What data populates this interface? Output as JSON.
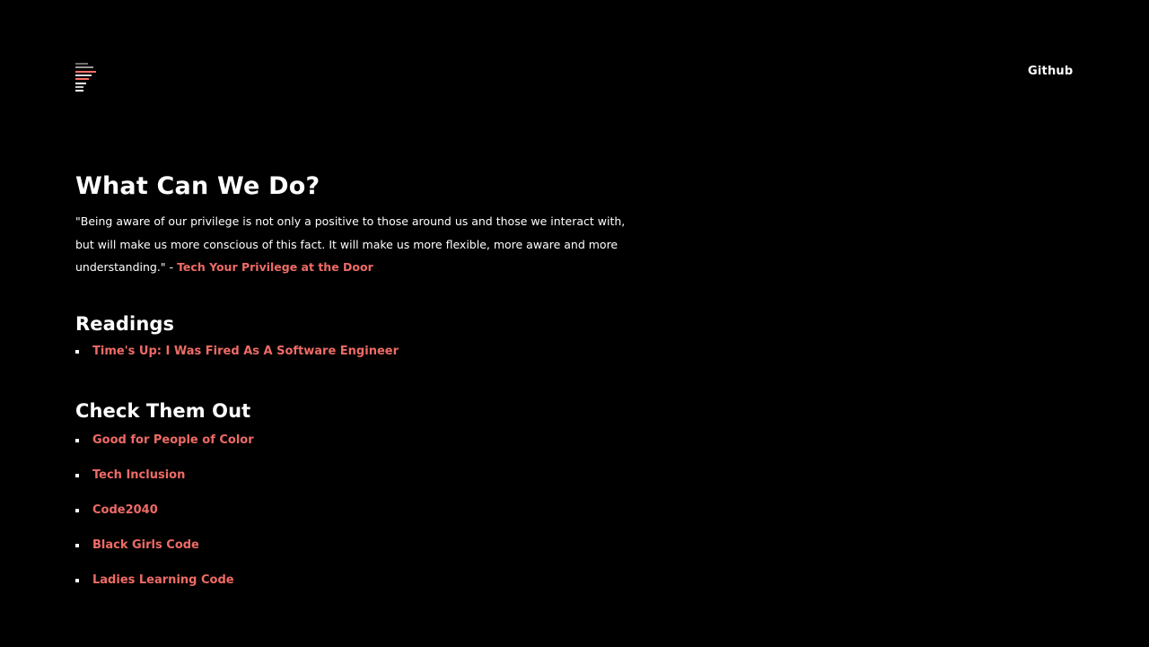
{
  "header": {
    "logo_colors": [
      "#6e6e6e",
      "#ff6f69",
      "#d9d9d9",
      "#ff6f69",
      "#ffffff",
      "#cccccc",
      "#ffffff"
    ],
    "nav": {
      "github_label": "Github"
    }
  },
  "main": {
    "title": "What Can We Do?",
    "quote": {
      "text": "\"Being aware of our privilege is not only a positive to those around us and those we interact with, but will make us more conscious of this fact. It will make us more flexible, more aware and more understanding.\" - ",
      "source_link": "Tech Your Privilege at the Door"
    },
    "readings": {
      "title": "Readings",
      "items": [
        "Time's Up: I Was Fired As A Software Engineer"
      ]
    },
    "resources": {
      "title": "Check Them Out",
      "items": [
        "Good for People of Color",
        "Tech Inclusion",
        "Code2040",
        "Black Girls Code",
        "Ladies Learning Code"
      ]
    }
  },
  "colors": {
    "background": "#000000",
    "text": "#ffffff",
    "accent": "#ee6b66"
  }
}
